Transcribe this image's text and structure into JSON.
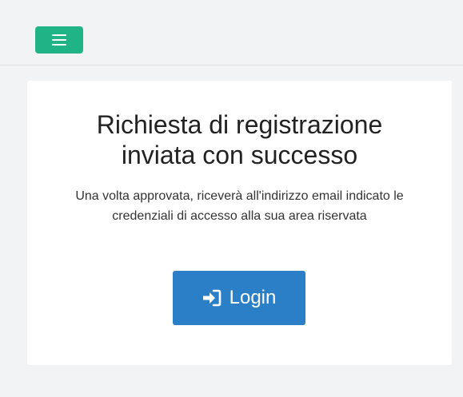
{
  "navbar": {
    "menu_icon": "hamburger-icon",
    "accent_color": "#1fb385"
  },
  "card": {
    "title_line1": "Richiesta di registrazione",
    "title_line2": "inviata con successo",
    "message_line1": "Una volta approvata, riceverà all'indirizzo email indicato le",
    "message_line2": "credenziali di accesso alla sua area riservata",
    "login_button": {
      "label": "Login",
      "icon": "sign-in-icon",
      "color": "#2a7fc7"
    }
  }
}
